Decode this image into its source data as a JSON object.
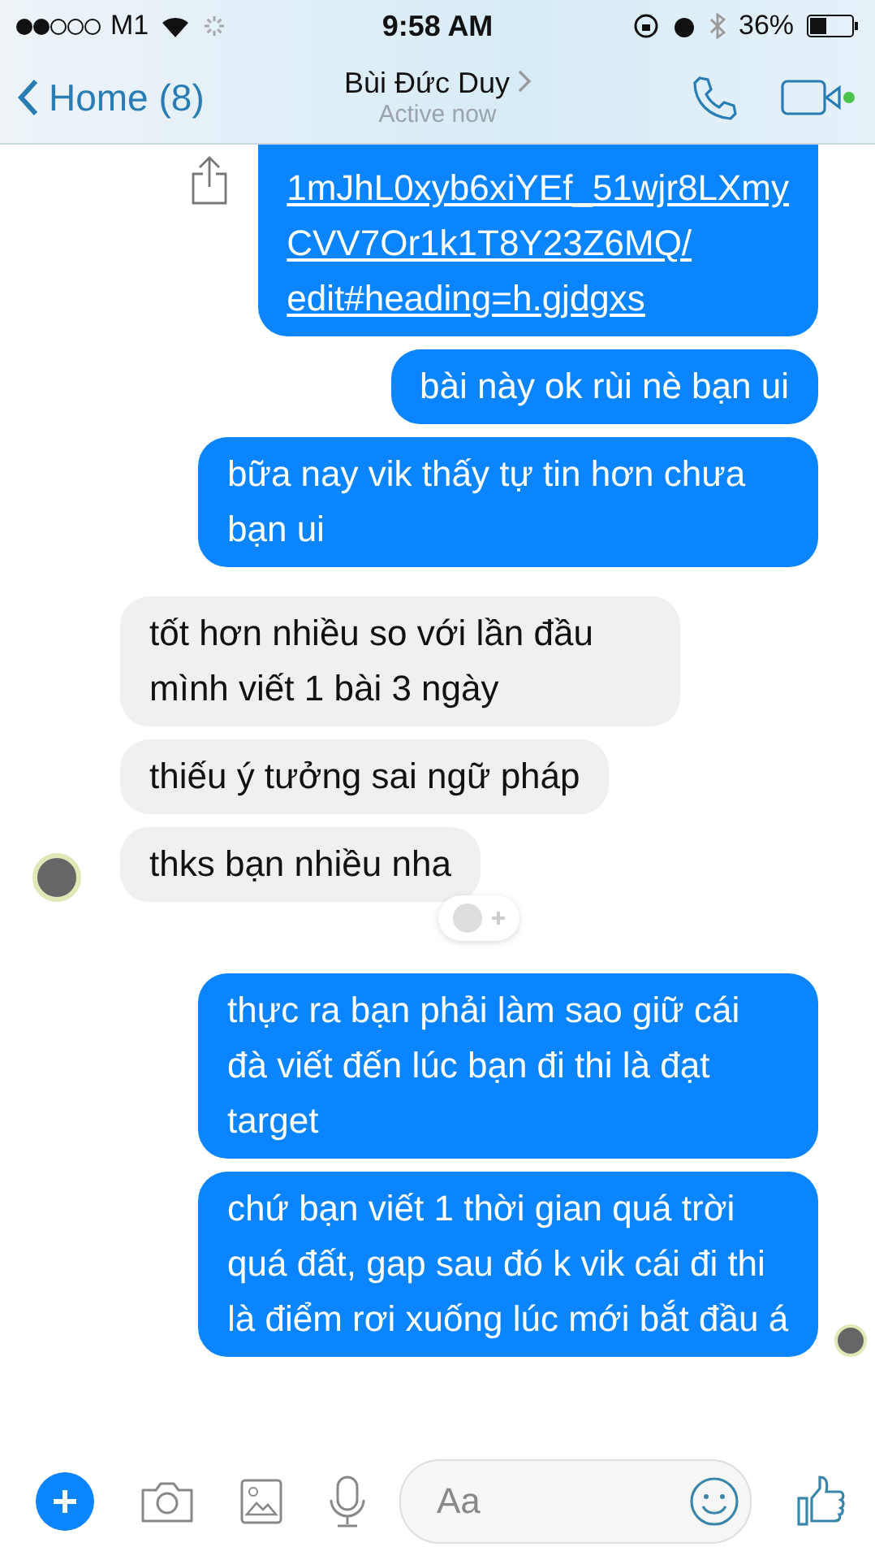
{
  "status_bar": {
    "carrier": "M1",
    "time": "9:58 AM",
    "battery": "36%"
  },
  "header": {
    "back_label": "Home (8)",
    "name": "Bùi Đức Duy",
    "status": "Active now"
  },
  "messages": [
    {
      "outgoing": true,
      "kind": "link",
      "lines": [
        "1mJhL0xyb6xiYEf_51wjr8LXmy",
        "CVV7Or1k1T8Y23Z6MQ/",
        "edit#heading=h.gjdgxs"
      ],
      "avatar": false,
      "reaction_button": false
    },
    {
      "outgoing": true,
      "kind": "text",
      "text": "bài này ok rùi nè bạn ui",
      "avatar": false,
      "reaction_button": false
    },
    {
      "outgoing": true,
      "kind": "text",
      "text": "bữa nay vik thấy tự tin hơn chưa bạn ui",
      "avatar": false,
      "reaction_button": false
    },
    {
      "outgoing": false,
      "kind": "text",
      "text": "tốt hơn nhiều so với lần đầu mình viết 1 bài 3 ngày",
      "avatar": false,
      "reaction_button": false
    },
    {
      "outgoing": false,
      "kind": "text",
      "text": "thiếu ý tưởng sai ngữ pháp",
      "avatar": false,
      "reaction_button": false
    },
    {
      "outgoing": false,
      "kind": "text",
      "text": "thks bạn nhiều nha",
      "avatar": true,
      "reaction_button": true
    },
    {
      "outgoing": true,
      "kind": "text",
      "text": "thực ra bạn phải làm sao giữ cái đà viết đến lúc bạn đi thi là đạt target",
      "avatar": false,
      "reaction_button": false
    },
    {
      "outgoing": true,
      "kind": "text",
      "text": "chứ bạn viết 1 thời gian quá trời quá đất, gap sau đó k vik cái đi thi là điểm rơi xuống lúc mới bắt đầu á",
      "avatar": true,
      "reaction_button": false
    }
  ],
  "composer": {
    "placeholder": "Aa"
  }
}
